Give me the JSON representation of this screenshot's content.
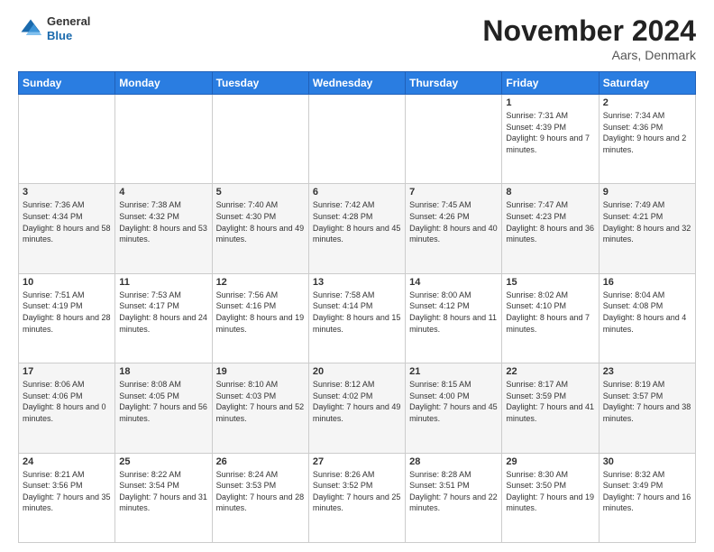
{
  "header": {
    "logo_general": "General",
    "logo_blue": "Blue",
    "month_title": "November 2024",
    "location": "Aars, Denmark"
  },
  "weekdays": [
    "Sunday",
    "Monday",
    "Tuesday",
    "Wednesday",
    "Thursday",
    "Friday",
    "Saturday"
  ],
  "weeks": [
    [
      {
        "day": "",
        "sunrise": "",
        "sunset": "",
        "daylight": ""
      },
      {
        "day": "",
        "sunrise": "",
        "sunset": "",
        "daylight": ""
      },
      {
        "day": "",
        "sunrise": "",
        "sunset": "",
        "daylight": ""
      },
      {
        "day": "",
        "sunrise": "",
        "sunset": "",
        "daylight": ""
      },
      {
        "day": "",
        "sunrise": "",
        "sunset": "",
        "daylight": ""
      },
      {
        "day": "1",
        "sunrise": "Sunrise: 7:31 AM",
        "sunset": "Sunset: 4:39 PM",
        "daylight": "Daylight: 9 hours and 7 minutes."
      },
      {
        "day": "2",
        "sunrise": "Sunrise: 7:34 AM",
        "sunset": "Sunset: 4:36 PM",
        "daylight": "Daylight: 9 hours and 2 minutes."
      }
    ],
    [
      {
        "day": "3",
        "sunrise": "Sunrise: 7:36 AM",
        "sunset": "Sunset: 4:34 PM",
        "daylight": "Daylight: 8 hours and 58 minutes."
      },
      {
        "day": "4",
        "sunrise": "Sunrise: 7:38 AM",
        "sunset": "Sunset: 4:32 PM",
        "daylight": "Daylight: 8 hours and 53 minutes."
      },
      {
        "day": "5",
        "sunrise": "Sunrise: 7:40 AM",
        "sunset": "Sunset: 4:30 PM",
        "daylight": "Daylight: 8 hours and 49 minutes."
      },
      {
        "day": "6",
        "sunrise": "Sunrise: 7:42 AM",
        "sunset": "Sunset: 4:28 PM",
        "daylight": "Daylight: 8 hours and 45 minutes."
      },
      {
        "day": "7",
        "sunrise": "Sunrise: 7:45 AM",
        "sunset": "Sunset: 4:26 PM",
        "daylight": "Daylight: 8 hours and 40 minutes."
      },
      {
        "day": "8",
        "sunrise": "Sunrise: 7:47 AM",
        "sunset": "Sunset: 4:23 PM",
        "daylight": "Daylight: 8 hours and 36 minutes."
      },
      {
        "day": "9",
        "sunrise": "Sunrise: 7:49 AM",
        "sunset": "Sunset: 4:21 PM",
        "daylight": "Daylight: 8 hours and 32 minutes."
      }
    ],
    [
      {
        "day": "10",
        "sunrise": "Sunrise: 7:51 AM",
        "sunset": "Sunset: 4:19 PM",
        "daylight": "Daylight: 8 hours and 28 minutes."
      },
      {
        "day": "11",
        "sunrise": "Sunrise: 7:53 AM",
        "sunset": "Sunset: 4:17 PM",
        "daylight": "Daylight: 8 hours and 24 minutes."
      },
      {
        "day": "12",
        "sunrise": "Sunrise: 7:56 AM",
        "sunset": "Sunset: 4:16 PM",
        "daylight": "Daylight: 8 hours and 19 minutes."
      },
      {
        "day": "13",
        "sunrise": "Sunrise: 7:58 AM",
        "sunset": "Sunset: 4:14 PM",
        "daylight": "Daylight: 8 hours and 15 minutes."
      },
      {
        "day": "14",
        "sunrise": "Sunrise: 8:00 AM",
        "sunset": "Sunset: 4:12 PM",
        "daylight": "Daylight: 8 hours and 11 minutes."
      },
      {
        "day": "15",
        "sunrise": "Sunrise: 8:02 AM",
        "sunset": "Sunset: 4:10 PM",
        "daylight": "Daylight: 8 hours and 7 minutes."
      },
      {
        "day": "16",
        "sunrise": "Sunrise: 8:04 AM",
        "sunset": "Sunset: 4:08 PM",
        "daylight": "Daylight: 8 hours and 4 minutes."
      }
    ],
    [
      {
        "day": "17",
        "sunrise": "Sunrise: 8:06 AM",
        "sunset": "Sunset: 4:06 PM",
        "daylight": "Daylight: 8 hours and 0 minutes."
      },
      {
        "day": "18",
        "sunrise": "Sunrise: 8:08 AM",
        "sunset": "Sunset: 4:05 PM",
        "daylight": "Daylight: 7 hours and 56 minutes."
      },
      {
        "day": "19",
        "sunrise": "Sunrise: 8:10 AM",
        "sunset": "Sunset: 4:03 PM",
        "daylight": "Daylight: 7 hours and 52 minutes."
      },
      {
        "day": "20",
        "sunrise": "Sunrise: 8:12 AM",
        "sunset": "Sunset: 4:02 PM",
        "daylight": "Daylight: 7 hours and 49 minutes."
      },
      {
        "day": "21",
        "sunrise": "Sunrise: 8:15 AM",
        "sunset": "Sunset: 4:00 PM",
        "daylight": "Daylight: 7 hours and 45 minutes."
      },
      {
        "day": "22",
        "sunrise": "Sunrise: 8:17 AM",
        "sunset": "Sunset: 3:59 PM",
        "daylight": "Daylight: 7 hours and 41 minutes."
      },
      {
        "day": "23",
        "sunrise": "Sunrise: 8:19 AM",
        "sunset": "Sunset: 3:57 PM",
        "daylight": "Daylight: 7 hours and 38 minutes."
      }
    ],
    [
      {
        "day": "24",
        "sunrise": "Sunrise: 8:21 AM",
        "sunset": "Sunset: 3:56 PM",
        "daylight": "Daylight: 7 hours and 35 minutes."
      },
      {
        "day": "25",
        "sunrise": "Sunrise: 8:22 AM",
        "sunset": "Sunset: 3:54 PM",
        "daylight": "Daylight: 7 hours and 31 minutes."
      },
      {
        "day": "26",
        "sunrise": "Sunrise: 8:24 AM",
        "sunset": "Sunset: 3:53 PM",
        "daylight": "Daylight: 7 hours and 28 minutes."
      },
      {
        "day": "27",
        "sunrise": "Sunrise: 8:26 AM",
        "sunset": "Sunset: 3:52 PM",
        "daylight": "Daylight: 7 hours and 25 minutes."
      },
      {
        "day": "28",
        "sunrise": "Sunrise: 8:28 AM",
        "sunset": "Sunset: 3:51 PM",
        "daylight": "Daylight: 7 hours and 22 minutes."
      },
      {
        "day": "29",
        "sunrise": "Sunrise: 8:30 AM",
        "sunset": "Sunset: 3:50 PM",
        "daylight": "Daylight: 7 hours and 19 minutes."
      },
      {
        "day": "30",
        "sunrise": "Sunrise: 8:32 AM",
        "sunset": "Sunset: 3:49 PM",
        "daylight": "Daylight: 7 hours and 16 minutes."
      }
    ]
  ]
}
